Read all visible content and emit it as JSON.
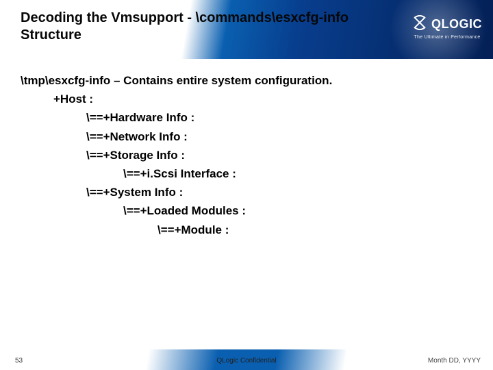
{
  "header": {
    "title": "Decoding the Vmsupport  - \\commands\\esxcfg-info Structure",
    "brand": "QLOGIC",
    "tagline": "The Ultimate in Performance"
  },
  "content": {
    "l0": "\\tmp\\esxcfg-info – Contains entire system configuration.",
    "l1": "+Host :",
    "l2a": "\\==+Hardware Info :",
    "l2b": "\\==+Network Info :",
    "l2c": "\\==+Storage Info :",
    "l3a": "\\==+i.Scsi Interface :",
    "l2d": "\\==+System Info :",
    "l3b": "\\==+Loaded Modules :",
    "l4a": "\\==+Module :"
  },
  "footer": {
    "page": "53",
    "confidential": "QLogic Confidential",
    "date": "Month DD, YYYY"
  }
}
